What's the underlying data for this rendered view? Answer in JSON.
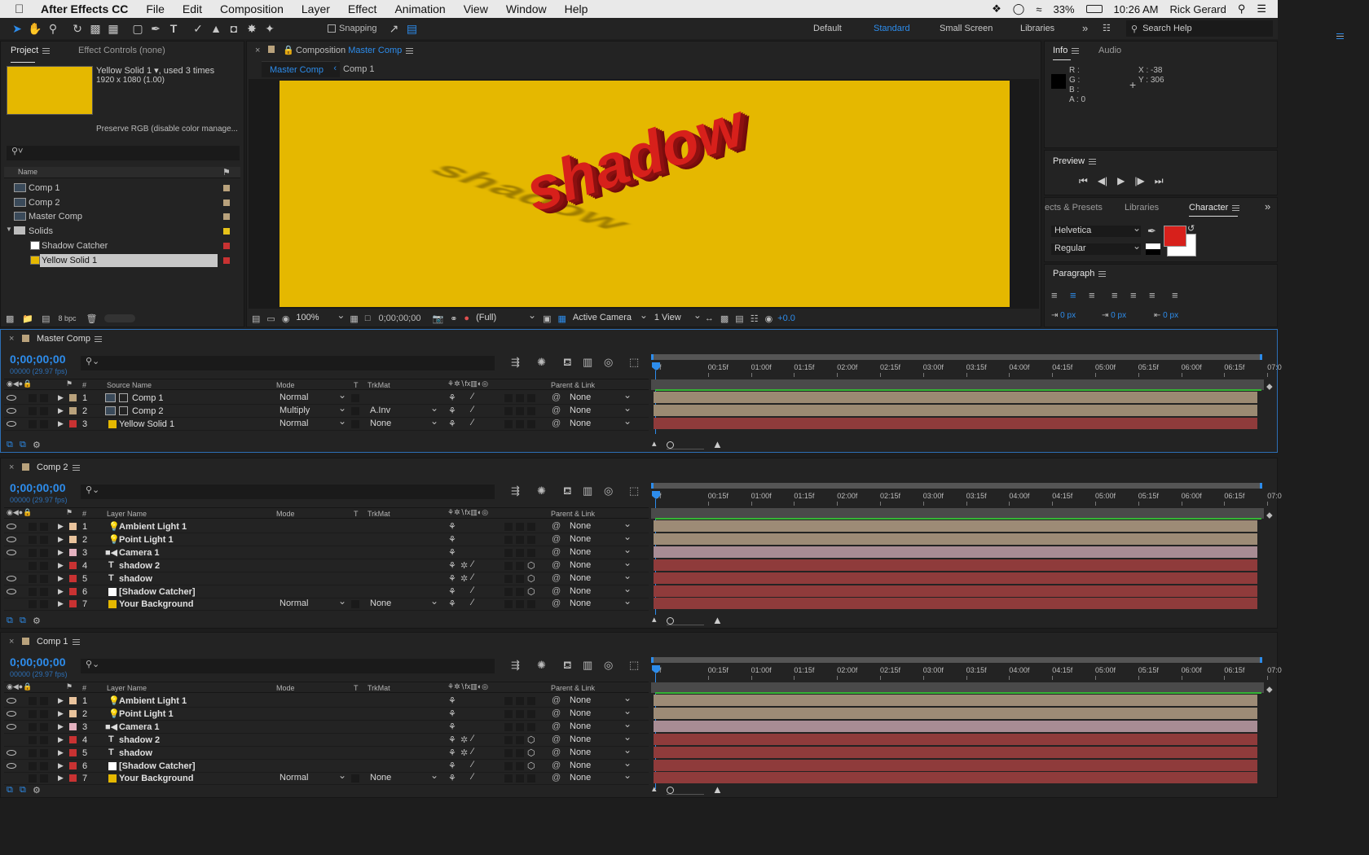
{
  "menubar": {
    "app": "After Effects CC",
    "items": [
      "File",
      "Edit",
      "Composition",
      "Layer",
      "Effect",
      "Animation",
      "View",
      "Window",
      "Help"
    ],
    "battery": "33%",
    "time": "10:26 AM",
    "user": "Rick Gerard"
  },
  "toolbar": {
    "snapping": "Snapping",
    "workspaces": [
      "Default",
      "Standard",
      "Small Screen",
      "Libraries"
    ],
    "active_workspace": "Standard",
    "search_placeholder": "Search Help"
  },
  "project": {
    "tab": "Project",
    "tab2": "Effect Controls (none)",
    "selected_name": "Yellow Solid 1",
    "used": ", used 3 times",
    "dims": "1920 x 1080 (1.00)",
    "color_note": "Preserve RGB (disable color manage...",
    "col_name": "Name",
    "bpc": "8 bpc",
    "items": [
      {
        "name": "Comp 1",
        "icon": "comp-icon",
        "color": "#b9a27c"
      },
      {
        "name": "Comp 2",
        "icon": "comp-icon",
        "color": "#b9a27c"
      },
      {
        "name": "Master Comp",
        "icon": "comp-icon",
        "color": "#b9a27c"
      },
      {
        "name": "Solids",
        "icon": "folder-icon",
        "color": "#e6c21a"
      },
      {
        "name": "Shadow Catcher",
        "icon": "solid-icon",
        "color": "#c83232",
        "swatch": "#ffffff"
      },
      {
        "name": "Yellow Solid 1",
        "icon": "solid-icon",
        "color": "#c83232",
        "swatch": "#e5b800"
      }
    ]
  },
  "viewer": {
    "title_prefix": "Composition",
    "comp_name": "Master Comp",
    "crumbs": [
      "Master Comp",
      "Comp 1"
    ],
    "canvas_text": "shadow",
    "bg_color": "#e5b800",
    "zoom": "100%",
    "timecode": "0;00;00;00",
    "resolution": "(Full)",
    "camera": "Active Camera",
    "views": "1 View",
    "exposure": "+0.0"
  },
  "info": {
    "tab": "Info",
    "tab2": "Audio",
    "r": "R :",
    "g": "G :",
    "b": "B :",
    "a": "A : 0",
    "x": "X : -38",
    "y": "Y : 306"
  },
  "preview": {
    "title": "Preview"
  },
  "character": {
    "tab_effects": "ects & Presets",
    "tab_libraries": "Libraries",
    "tab": "Character",
    "font": "Helvetica",
    "style": "Regular",
    "fill_color": "#d7201b"
  },
  "paragraph": {
    "title": "Paragraph",
    "indent1": "0 px",
    "indent2": "0 px",
    "indent3": "0 px"
  },
  "ruler": [
    "0f",
    "00:15f",
    "01:00f",
    "01:15f",
    "02:00f",
    "02:15f",
    "03:00f",
    "03:15f",
    "04:00f",
    "04:15f",
    "05:00f",
    "05:15f",
    "06:00f",
    "06:15f",
    "07:0"
  ],
  "timelines": [
    {
      "name": "Master Comp",
      "timecode": "0;00;00;00",
      "fps": "00000 (29.97 fps)",
      "col_name": "Source Name",
      "col_mode": "Mode",
      "col_t": "T",
      "col_trk": "TrkMat",
      "col_parent": "Parent & Link",
      "layers": [
        {
          "n": "1",
          "name": "Comp 1",
          "color": "#b9a27c",
          "icon": "comp-icon",
          "mode": "Normal",
          "trk": "",
          "parent": "None",
          "bar": "#9b8a72"
        },
        {
          "n": "2",
          "name": "Comp 2",
          "color": "#b9a27c",
          "icon": "comp-icon",
          "mode": "Multiply",
          "trk": "A.Inv",
          "parent": "None",
          "bar": "#9b8a72"
        },
        {
          "n": "3",
          "name": "Yellow Solid 1",
          "color": "#c83232",
          "icon": "solid-icon",
          "mode": "Normal",
          "trk": "None",
          "parent": "None",
          "bar": "#8f3b3b"
        }
      ]
    },
    {
      "name": "Comp 2",
      "timecode": "0;00;00;00",
      "fps": "00000 (29.97 fps)",
      "col_name": "Layer Name",
      "col_mode": "Mode",
      "col_t": "T",
      "col_trk": "TrkMat",
      "col_parent": "Parent & Link",
      "layers": [
        {
          "n": "1",
          "name": "Ambient Light 1",
          "color": "#e9c39c",
          "icon": "light-icon",
          "mode": "",
          "trk": "",
          "parent": "None",
          "bar": "#9d8b76"
        },
        {
          "n": "2",
          "name": "Point Light 1",
          "color": "#e9c39c",
          "icon": "light-icon",
          "mode": "",
          "trk": "",
          "parent": "None",
          "bar": "#9d8b76"
        },
        {
          "n": "3",
          "name": "Camera 1",
          "color": "#e4b2c0",
          "icon": "camera-icon",
          "mode": "",
          "trk": "",
          "parent": "None",
          "bar": "#a88c94"
        },
        {
          "n": "4",
          "name": "shadow 2",
          "color": "#c83232",
          "icon": "text-icon",
          "mode": "",
          "trk": "",
          "parent": "None",
          "bar": "#8f3b3b"
        },
        {
          "n": "5",
          "name": "shadow",
          "color": "#c83232",
          "icon": "text-icon",
          "mode": "",
          "trk": "",
          "parent": "None",
          "bar": "#8f3b3b"
        },
        {
          "n": "6",
          "name": "[Shadow Catcher]",
          "color": "#c83232",
          "icon": "solid-icon",
          "mode": "",
          "trk": "",
          "parent": "None",
          "bar": "#8f3b3b"
        },
        {
          "n": "7",
          "name": "Your Background",
          "color": "#c83232",
          "icon": "solid-icon",
          "mode": "Normal",
          "trk": "None",
          "parent": "None",
          "bar": "#8f3b3b"
        }
      ]
    },
    {
      "name": "Comp 1",
      "timecode": "0;00;00;00",
      "fps": "00000 (29.97 fps)",
      "col_name": "Layer Name",
      "col_mode": "Mode",
      "col_t": "T",
      "col_trk": "TrkMat",
      "col_parent": "Parent & Link",
      "layers": [
        {
          "n": "1",
          "name": "Ambient Light 1",
          "color": "#e9c39c",
          "icon": "light-icon",
          "mode": "",
          "trk": "",
          "parent": "None",
          "bar": "#9d8b76"
        },
        {
          "n": "2",
          "name": "Point Light 1",
          "color": "#e9c39c",
          "icon": "light-icon",
          "mode": "",
          "trk": "",
          "parent": "None",
          "bar": "#9d8b76"
        },
        {
          "n": "3",
          "name": "Camera 1",
          "color": "#e4b2c0",
          "icon": "camera-icon",
          "mode": "",
          "trk": "",
          "parent": "None",
          "bar": "#a88c94"
        },
        {
          "n": "4",
          "name": "shadow 2",
          "color": "#c83232",
          "icon": "text-icon",
          "mode": "",
          "trk": "",
          "parent": "None",
          "bar": "#8f3b3b"
        },
        {
          "n": "5",
          "name": "shadow",
          "color": "#c83232",
          "icon": "text-icon",
          "mode": "",
          "trk": "",
          "parent": "None",
          "bar": "#8f3b3b"
        },
        {
          "n": "6",
          "name": "[Shadow Catcher]",
          "color": "#c83232",
          "icon": "solid-icon",
          "mode": "",
          "trk": "",
          "parent": "None",
          "bar": "#8f3b3b"
        },
        {
          "n": "7",
          "name": "Your Background",
          "color": "#c83232",
          "icon": "solid-icon",
          "mode": "Normal",
          "trk": "None",
          "parent": "None",
          "bar": "#8f3b3b"
        }
      ]
    }
  ]
}
